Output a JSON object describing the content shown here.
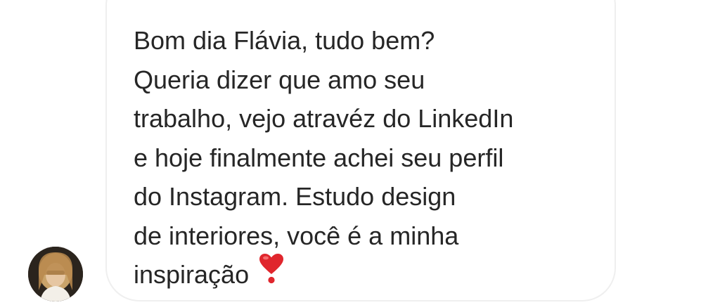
{
  "conversation": {
    "message": {
      "lines": [
        "Bom dia Flávia, tudo bem?",
        "Queria dizer que amo seu",
        "trabalho, vejo atravéz do LinkedIn",
        "e hoje finalmente achei seu perfil",
        "do Instagram. Estudo design",
        "de interiores, você é a minha",
        "inspiração"
      ],
      "trailing_emoji": "heart-exclamation-icon"
    },
    "sender": {
      "avatar_icon": "user-avatar"
    },
    "colors": {
      "text": "#262626",
      "bubble_border": "#efefef",
      "emoji": "#e0262d"
    }
  }
}
